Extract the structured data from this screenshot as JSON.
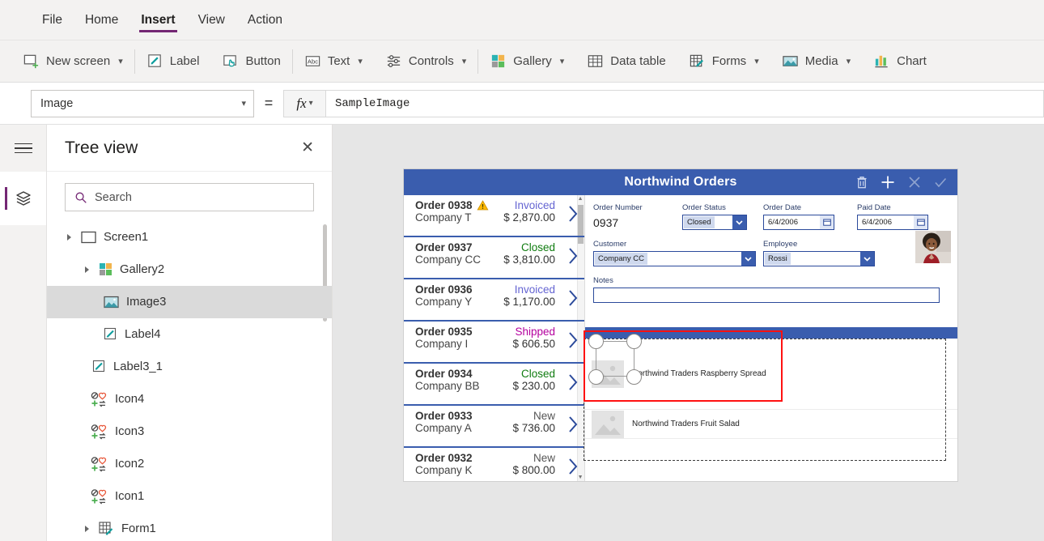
{
  "menu": {
    "tabs": [
      {
        "label": "File",
        "active": false
      },
      {
        "label": "Home",
        "active": false
      },
      {
        "label": "Insert",
        "active": true
      },
      {
        "label": "View",
        "active": false
      },
      {
        "label": "Action",
        "active": false
      }
    ]
  },
  "ribbon": {
    "items": [
      {
        "label": "New screen",
        "icon": "new-screen-icon",
        "caret": true
      },
      {
        "label": "Label",
        "icon": "label-icon",
        "caret": false
      },
      {
        "label": "Button",
        "icon": "button-icon",
        "caret": false
      },
      {
        "label": "Text",
        "icon": "text-icon",
        "caret": true
      },
      {
        "label": "Controls",
        "icon": "controls-icon",
        "caret": true
      },
      {
        "label": "Gallery",
        "icon": "gallery-icon",
        "caret": true
      },
      {
        "label": "Data table",
        "icon": "data-table-icon",
        "caret": false
      },
      {
        "label": "Forms",
        "icon": "forms-icon",
        "caret": true
      },
      {
        "label": "Media",
        "icon": "media-icon",
        "caret": true
      },
      {
        "label": "Chart",
        "icon": "chart-icon",
        "caret": false
      }
    ]
  },
  "formula_bar": {
    "property": "Image",
    "equals": "=",
    "fx_label": "fx",
    "expression": "SampleImage"
  },
  "tree_panel": {
    "title": "Tree view",
    "close_label": "✕",
    "search_placeholder": "Search",
    "nodes": [
      {
        "label": "Screen1",
        "indent": 0,
        "icon": "screen-icon",
        "expandable": true,
        "selected": false
      },
      {
        "label": "Gallery2",
        "indent": 1,
        "icon": "gallery-icon",
        "expandable": true,
        "selected": false
      },
      {
        "label": "Image3",
        "indent": 2,
        "icon": "image-icon",
        "expandable": false,
        "selected": true
      },
      {
        "label": "Label4",
        "indent": 2,
        "icon": "label-icon",
        "expandable": false,
        "selected": false
      },
      {
        "label": "Label3_1",
        "indent": 1,
        "icon": "label-icon",
        "expandable": false,
        "selected": false
      },
      {
        "label": "Icon4",
        "indent": 1,
        "icon": "icons-icon",
        "expandable": false,
        "selected": false
      },
      {
        "label": "Icon3",
        "indent": 1,
        "icon": "icons-icon",
        "expandable": false,
        "selected": false
      },
      {
        "label": "Icon2",
        "indent": 1,
        "icon": "icons-icon",
        "expandable": false,
        "selected": false
      },
      {
        "label": "Icon1",
        "indent": 1,
        "icon": "icons-icon",
        "expandable": false,
        "selected": false
      },
      {
        "label": "Form1",
        "indent": 1,
        "icon": "form-icon",
        "expandable": true,
        "selected": false
      }
    ]
  },
  "app_preview": {
    "header_title": "Northwind Orders",
    "header_icons": [
      {
        "name": "trash-icon",
        "enabled": true
      },
      {
        "name": "plus-icon",
        "enabled": true
      },
      {
        "name": "close-icon",
        "enabled": false
      },
      {
        "name": "check-icon",
        "enabled": false
      }
    ],
    "orders": [
      {
        "id": "Order 0938",
        "company": "Company T",
        "status": "Invoiced",
        "status_color": "#6464d2",
        "amount": "$ 2,870.00",
        "warning": true
      },
      {
        "id": "Order 0937",
        "company": "Company CC",
        "status": "Closed",
        "status_color": "#107c10",
        "amount": "$ 3,810.00",
        "warning": false
      },
      {
        "id": "Order 0936",
        "company": "Company Y",
        "status": "Invoiced",
        "status_color": "#6464d2",
        "amount": "$ 1,170.00",
        "warning": false
      },
      {
        "id": "Order 0935",
        "company": "Company I",
        "status": "Shipped",
        "status_color": "#b4009e",
        "amount": "$ 606.50",
        "warning": false
      },
      {
        "id": "Order 0934",
        "company": "Company BB",
        "status": "Closed",
        "status_color": "#107c10",
        "amount": "$ 230.00",
        "warning": false
      },
      {
        "id": "Order 0933",
        "company": "Company A",
        "status": "New",
        "status_color": "#555555",
        "amount": "$ 736.00",
        "warning": false
      },
      {
        "id": "Order 0932",
        "company": "Company K",
        "status": "New",
        "status_color": "#555555",
        "amount": "$ 800.00",
        "warning": false
      }
    ],
    "form": {
      "order_number_label": "Order Number",
      "order_number_value": "0937",
      "order_status_label": "Order Status",
      "order_status_value": "Closed",
      "order_date_label": "Order Date",
      "order_date_value": "6/4/2006",
      "paid_date_label": "Paid Date",
      "paid_date_value": "6/4/2006",
      "customer_label": "Customer",
      "customer_value": "Company CC",
      "employee_label": "Employee",
      "employee_value": "Rossi",
      "notes_label": "Notes",
      "notes_value": ""
    },
    "detail_gallery": [
      {
        "caption": "Northwind Traders Raspberry Spread",
        "selected": true
      },
      {
        "caption": "Northwind Traders Fruit Salad",
        "selected": false
      }
    ]
  },
  "colors": {
    "accent_purple": "#742774",
    "app_blue": "#3a5dae",
    "selection_red": "#ff1111",
    "canvas_bg": "#e6e6e6"
  }
}
